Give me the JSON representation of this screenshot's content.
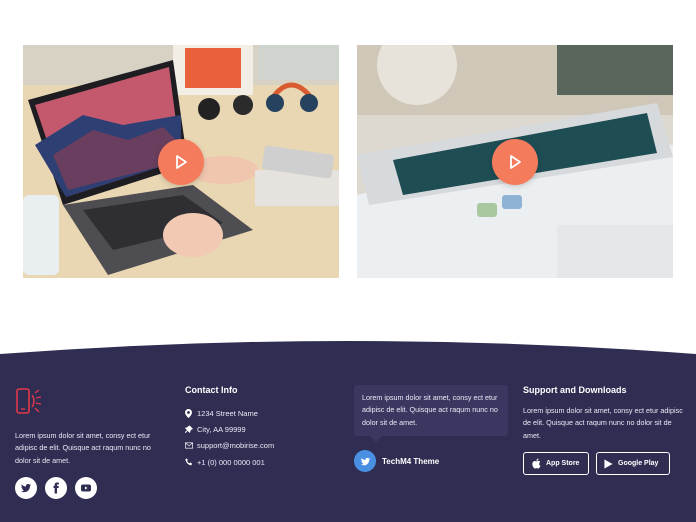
{
  "videos": [
    {
      "name": "laptop-video",
      "play_icon": "play-icon"
    },
    {
      "name": "phone-video",
      "play_icon": "play-icon"
    }
  ],
  "footer": {
    "brand": {
      "icon": "phone-icon",
      "description": "Lorem ipsum dolor sit amet, consy ect etur adipisc de elit. Quisque act raqum nunc no dolor sit de amet."
    },
    "socials": [
      {
        "icon": "twitter-icon"
      },
      {
        "icon": "facebook-icon"
      },
      {
        "icon": "youtube-icon"
      }
    ],
    "contact": {
      "heading": "Contact Info",
      "address": "1234 Street Name",
      "city": "City, AA 99999",
      "email": "support@mobirise.com",
      "phone": "+1 (0) 000 0000 001"
    },
    "tweet": {
      "text": "Lorem ipsum dolor sit amet, consy ect etur adipisc de elit. Quisque act raqum nunc no dolor sit de amet.",
      "author": "TechM4 Theme"
    },
    "support": {
      "heading": "Support and Downloads",
      "text": "Lorem ipsum dolor sit amet, consy ect etur adipisc de elit. Quisque act raqum nunc no dolor sit de amet.",
      "app_store_label": "App Store",
      "google_play_label": "Google Play"
    },
    "colors": {
      "background": "#2f2d52",
      "accent": "#f47b5c"
    }
  }
}
